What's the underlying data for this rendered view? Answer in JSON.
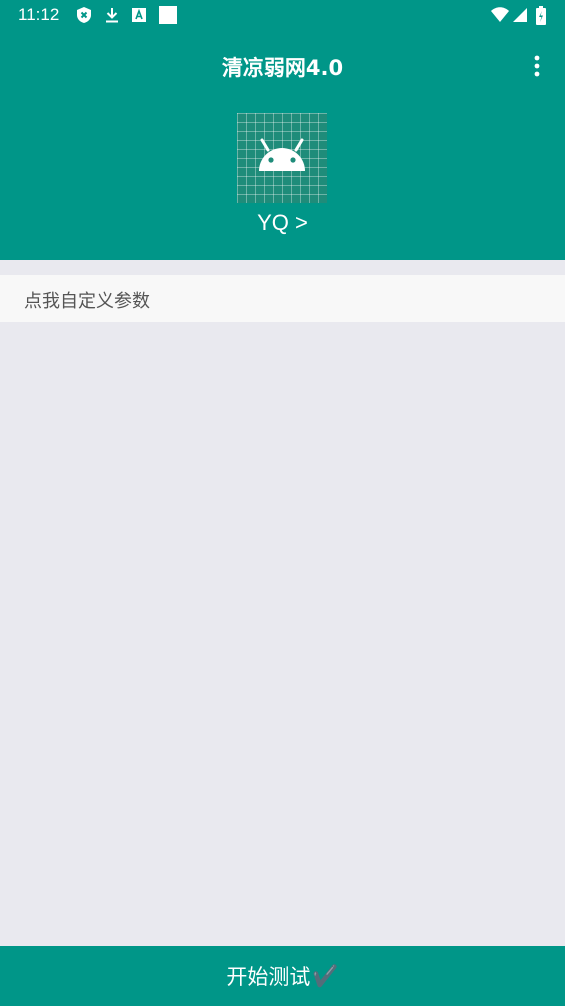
{
  "status_bar": {
    "time": "11:12",
    "left_icons": [
      "shield-icon",
      "download-icon",
      "a-box-icon",
      "square-icon"
    ],
    "right_icons": [
      "wifi-icon",
      "signal-icon",
      "battery-icon"
    ]
  },
  "app_bar": {
    "title": "清凉弱网4.0",
    "menu_icon": "more-vertical-icon"
  },
  "profile": {
    "avatar_icon": "android-icon",
    "name_link": "YQ >"
  },
  "custom_params": {
    "label": "点我自定义参数"
  },
  "start_button": {
    "label": "开始测试",
    "check_glyph": "✔️"
  },
  "colors": {
    "primary": "#009688",
    "background": "#e9e9ef",
    "row_background": "#f8f8f8"
  }
}
